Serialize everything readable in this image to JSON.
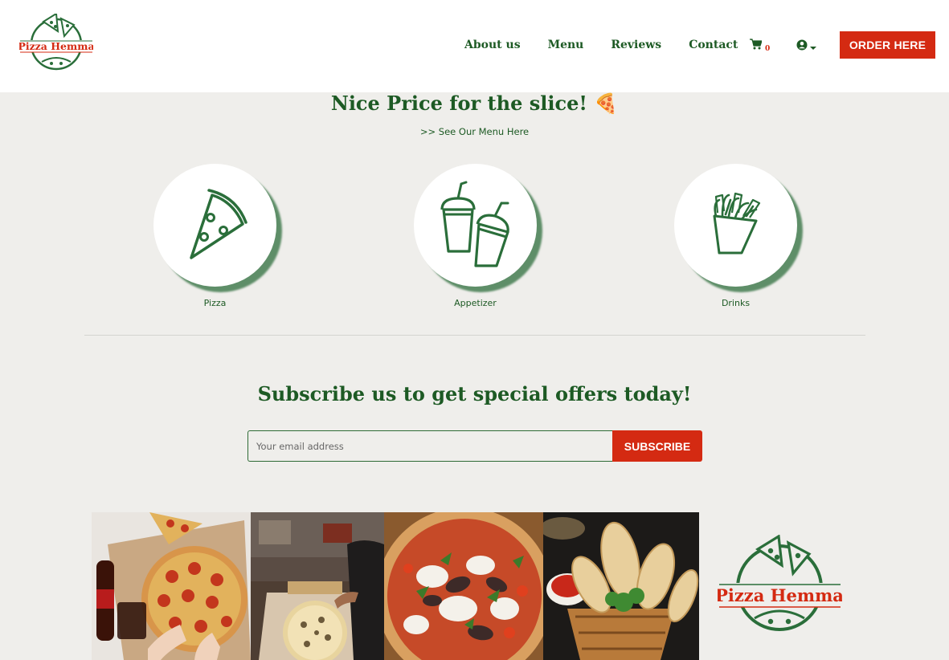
{
  "brand": {
    "name": "Pizza Hemma"
  },
  "nav": {
    "links": [
      "About us",
      "Menu",
      "Reviews",
      "Contact"
    ],
    "cart_count": "0",
    "order_button": "ORDER HERE"
  },
  "hero": {
    "title": "Nice Price for the slice! 🍕",
    "menu_link": ">> See Our Menu Here"
  },
  "categories": [
    {
      "label": "Pizza",
      "icon": "pizza-slice-icon"
    },
    {
      "label": "Appetizer",
      "icon": "drink-cups-icon"
    },
    {
      "label": "Drinks",
      "icon": "fries-icon"
    }
  ],
  "subscribe": {
    "title": "Subscribe us to get special offers today!",
    "placeholder": "Your email address",
    "button": "SUBSCRIBE"
  },
  "gallery": {
    "images": [
      "pepperoni-pizza-photo",
      "pizza-kitchen-photo",
      "grilled-vegetable-pizza-photo",
      "garlic-bread-basket-photo"
    ]
  },
  "colors": {
    "brand_green": "#1d5a24",
    "accent_red": "#d42a12",
    "background": "#efeeeb"
  }
}
